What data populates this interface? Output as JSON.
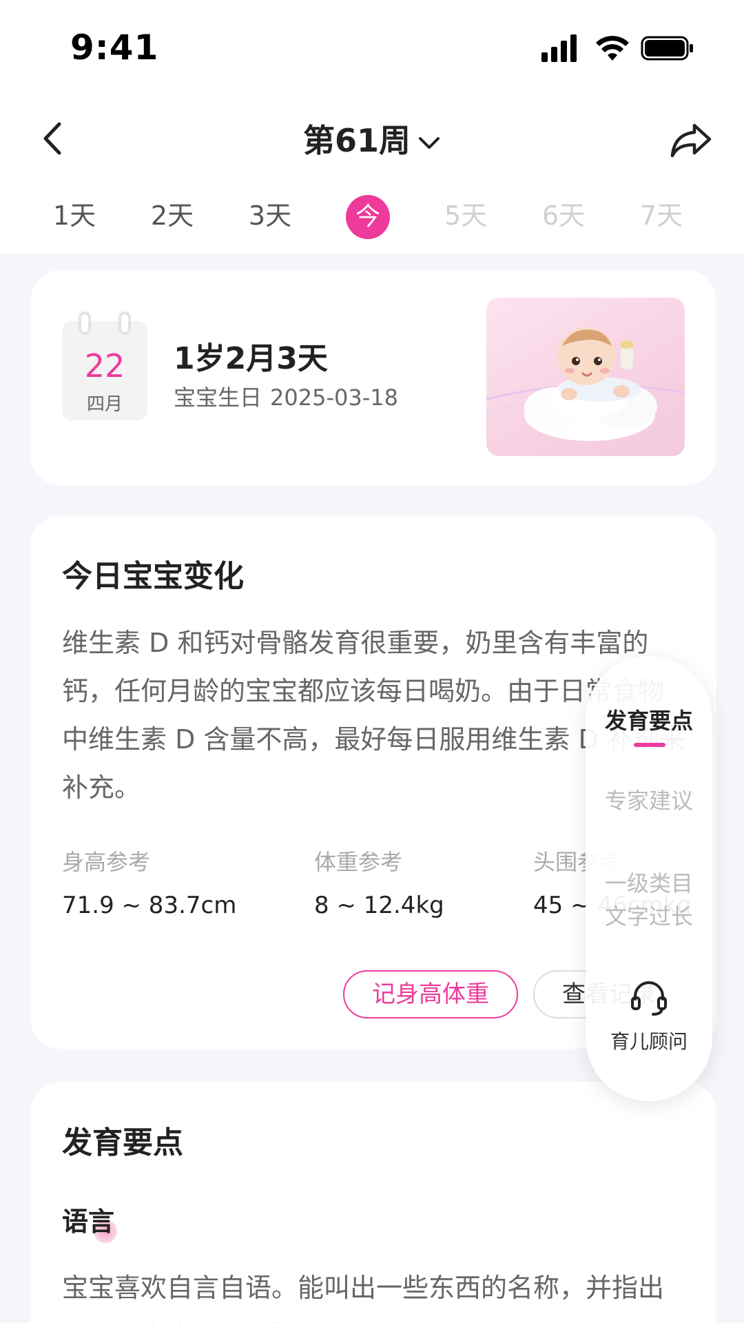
{
  "status_bar": {
    "time": "9:41"
  },
  "nav": {
    "title": "第61周"
  },
  "day_tabs": [
    {
      "label": "1天",
      "state": "past"
    },
    {
      "label": "2天",
      "state": "past"
    },
    {
      "label": "3天",
      "state": "past"
    },
    {
      "label": "今",
      "state": "today"
    },
    {
      "label": "5天",
      "state": "future"
    },
    {
      "label": "6天",
      "state": "future"
    },
    {
      "label": "7天",
      "state": "future"
    }
  ],
  "header_card": {
    "calendar_day": "22",
    "calendar_month": "四月",
    "age": "1岁2月3天",
    "birthday_label": "宝宝生日",
    "birthday_date": "2025-03-18"
  },
  "today_card": {
    "title": "今日宝宝变化",
    "description": "维生素 D 和钙对骨骼发育很重要，奶里含有丰富的钙，任何月龄的宝宝都应该每日喝奶。由于日常食物中维生素 D 含量不高，最好每日服用维生素 D 补剂来补充。",
    "references": [
      {
        "label": "身高参考",
        "value": "71.9 ~ 83.7cm"
      },
      {
        "label": "体重参考",
        "value": "8 ~ 12.4kg"
      },
      {
        "label": "头围参考",
        "value": "45 ~ 46cmkg"
      }
    ],
    "record_button": "记身高体重",
    "view_button": "查看记录"
  },
  "dev_card": {
    "title": "发育要点",
    "subtitle": "语言",
    "text": "宝宝喜欢自言自语。能叫出一些东西的名称，并指出方向，宝宝不但能指出自己身体部位的名称，还"
  },
  "side_panel": {
    "items": [
      "发育要点",
      "专家建议",
      "一级类目文字过长"
    ],
    "active_index": 0,
    "advisor_label": "育儿顾问"
  },
  "colors": {
    "accent": "#ee3a9b",
    "background": "#f6f5fb"
  },
  "icons": [
    "back-arrow-icon",
    "chevron-down-icon",
    "share-icon",
    "signal-icon",
    "wifi-icon",
    "battery-icon",
    "headset-icon"
  ]
}
